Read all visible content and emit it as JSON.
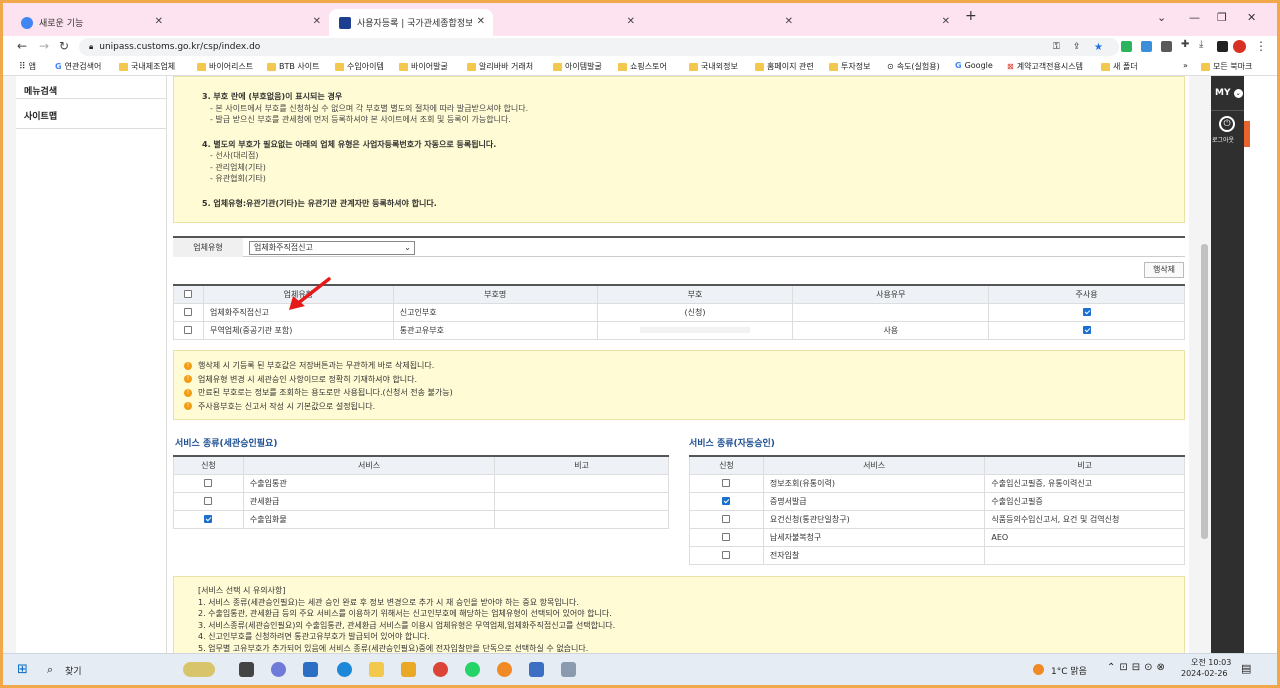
{
  "tabs": [
    {
      "title": "새로운 기능"
    },
    {
      "title": ""
    },
    {
      "title": "사용자등록 | 국가관세종합정보"
    },
    {
      "title": ""
    },
    {
      "title": ""
    },
    {
      "title": ""
    }
  ],
  "address": {
    "url": "unipass.customs.go.kr/csp/index.do"
  },
  "bookmarks": [
    "앱",
    "연관검색어",
    "국내제조업체",
    "바이어리스트",
    "BTB 사이트",
    "수입아이템",
    "바이어발굴",
    "알리바바 거래처",
    "아이템발굴",
    "쇼핑스토어",
    "국내외정보",
    "홈페이지 관련",
    "투자정보",
    "속도(실험용)",
    "Google",
    "계약고객전용시스템",
    "새 폴더",
    "모든 북마크"
  ],
  "left_menu": [
    "메뉴검색",
    "사이트맵"
  ],
  "notice": {
    "item3": "3. 부호 란에 (부호없음)이 표시되는 경우",
    "item3_sub": [
      "- 본 사이트에서 부호를 신청하실 수 없으며 각 부호별 별도의 절차에 따라 발급받으셔야 합니다.",
      "- 발급 받으신 부호를 관세청에 먼저 등록하셔야 본 사이트에서 조회 및 등록이 가능합니다."
    ],
    "item4": "4. 별도의 부호가 필요없는 아래의 업체 유형은 사업자등록번호가 자동으로 등록됩니다.",
    "item4_sub": [
      "- 선사(대리점)",
      "- 관리업체(기타)",
      "- 유관협회(기타)"
    ],
    "item5": "5. 업체유형:유관기관(기타)는 유관기관 관계자만 등록하셔야 합니다."
  },
  "type_row": {
    "label": "업체유형",
    "selected": "업체화주직접신고"
  },
  "delete_button": "행삭제",
  "code_table": {
    "headers": [
      "업체유형",
      "부호명",
      "부호",
      "사용유무",
      "주사용"
    ],
    "rows": [
      {
        "type": "업체화주직접신고",
        "name": "신고인부호",
        "code": "(신청)",
        "use": "",
        "main": true
      },
      {
        "type": "무역업체(중공기관 포함)",
        "name": "통관고유부호",
        "code": "",
        "use": "사용",
        "main": true
      }
    ]
  },
  "warnings": [
    "행삭제 시 기등록 된 부호값은 저장버튼과는 무관하게 바로 삭제됩니다.",
    "업체유형 변경 시 세관승인 사항이므로 정확히 기재하셔야 합니다.",
    "만료된 부호로는 정보를 조회하는 용도로만 사용됩니다.(신청서 전송 불가능)",
    "주사용부호는 신고서 작성 시 기본값으로 설정됩니다."
  ],
  "svc_left": {
    "title": "서비스 종류(세관승인필요)",
    "headers": [
      "신청",
      "서비스",
      "비고"
    ],
    "rows": [
      {
        "checked": false,
        "service": "수출입통관",
        "note": ""
      },
      {
        "checked": false,
        "service": "관세환급",
        "note": ""
      },
      {
        "checked": true,
        "service": "수출입화물",
        "note": ""
      }
    ]
  },
  "svc_right": {
    "title": "서비스 종류(자동승인)",
    "headers": [
      "신청",
      "서비스",
      "비고"
    ],
    "rows": [
      {
        "checked": false,
        "service": "정보조회(유통이력)",
        "note": "수출입신고필증, 유통이력신고"
      },
      {
        "checked": true,
        "service": "증명서발급",
        "note": "수출입신고필증"
      },
      {
        "checked": false,
        "service": "요건신청(통관단일창구)",
        "note": "식품등의수입신고서, 요건 및 검역신청"
      },
      {
        "checked": false,
        "service": "납세자불복청구",
        "note": "AEO"
      },
      {
        "checked": false,
        "service": "전자입찰",
        "note": ""
      }
    ]
  },
  "bottom_notice": {
    "title": "[서비스 선택 시 유의사항]",
    "items": [
      "1. 서비스 종류(세관승인필요)는 세관 승인 완료 후 정보 변경으로 추가 시 재 승인을 받아야 하는 중요 항목입니다.",
      "2. 수출입통관, 관세환급 등의 주요 서비스를 이용하기 위해서는 신고인부호에 해당하는 업체유형이 선택되어 있어야 합니다.",
      "3. 서비스종류(세관승인필요)의 수출입통관, 관세환급 서비스를 이용시 업체유형은 무역업체,업체화주직접신고를 선택합니다.",
      "4. 신고인부호를 신청하려면 통관고유부호가 발급되어 있어야 합니다.",
      "5. 업무별 고유부호가 추가되어 있음에 서비스 종류(세관승인필요)중에 전자입찰만을 단독으로 선택하실 수 없습니다."
    ]
  },
  "right_panel": {
    "my": "MY",
    "logout": "로그아웃"
  },
  "taskbar": {
    "search": "찾기",
    "weather": "1°C 맑음",
    "time": "오전 10:03",
    "date": "2024-02-26"
  },
  "colors": {
    "frame": "#f1a84a",
    "accent": "#1b6fd0",
    "note_bg": "#fffbd4",
    "arrow": "#e31b1b"
  }
}
